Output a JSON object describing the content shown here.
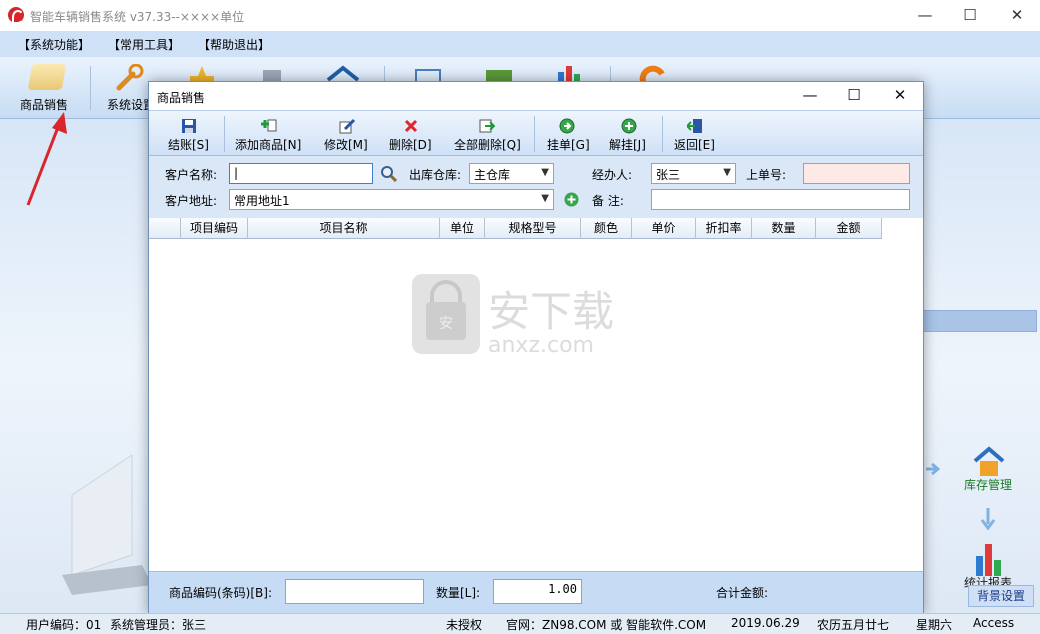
{
  "window": {
    "title": "智能车辆销售系统 v37.33--××××单位",
    "controls": [
      "—",
      "☐",
      "✕"
    ]
  },
  "menu": [
    "【系统功能】",
    "【常用工具】",
    "【帮助退出】"
  ],
  "toolbar": {
    "sales_label": "商品销售",
    "settings_label": "系统设置"
  },
  "dialog": {
    "title": "商品销售",
    "controls": [
      "—",
      "☐",
      "✕"
    ],
    "toolbar": [
      {
        "label": "结账[S]",
        "icon": "save-icon"
      },
      {
        "label": "添加商品[N]",
        "icon": "add-item-icon"
      },
      {
        "label": "修改[M]",
        "icon": "edit-icon"
      },
      {
        "label": "删除[D]",
        "icon": "delete-icon"
      },
      {
        "label": "全部删除[Q]",
        "icon": "delete-all-icon"
      },
      {
        "label": "挂单[G]",
        "icon": "hold-icon"
      },
      {
        "label": "解挂[J]",
        "icon": "unhold-icon"
      },
      {
        "label": "返回[E]",
        "icon": "return-icon"
      }
    ],
    "form": {
      "customer_name_label": "客户名称:",
      "customer_name_value": "|",
      "warehouse_label": "出库仓库:",
      "warehouse_value": "主仓库",
      "handler_label": "经办人:",
      "handler_value": "张三",
      "prev_order_label": "上单号:",
      "prev_order_value": "",
      "address_label": "客户地址:",
      "address_value": "常用地址1",
      "remark_label": "备  注:",
      "remark_value": ""
    },
    "columns": [
      "项目编码",
      "项目名称",
      "单位",
      "规格型号",
      "颜色",
      "单价",
      "折扣率",
      "数量",
      "金额"
    ],
    "footer": {
      "barcode_label": "商品编码(条码)[B]:",
      "barcode_value": "",
      "qty_label": "数量[L]:",
      "qty_value": "1.00",
      "total_label": "合计金额:"
    }
  },
  "watermark": {
    "text_cn": "安下载",
    "text_en": "anxz.com"
  },
  "side": {
    "stock_label": "库存管理",
    "stats_label": "统计报表",
    "bg_settings_label": "背景设置"
  },
  "status": {
    "user_code": "用户编码：01",
    "admin": "系统管理员：张三",
    "license": "未授权",
    "website": "官网：ZN98.COM 或 智能软件.COM",
    "date": "2019.06.29",
    "lunar": "农历五月廿七",
    "weekday": "星期六",
    "db": "Access"
  },
  "colors": {
    "accent_red": "#d7262b",
    "form_bg": "#d9e7f7",
    "prev_order_bg": "#fde9e6"
  }
}
